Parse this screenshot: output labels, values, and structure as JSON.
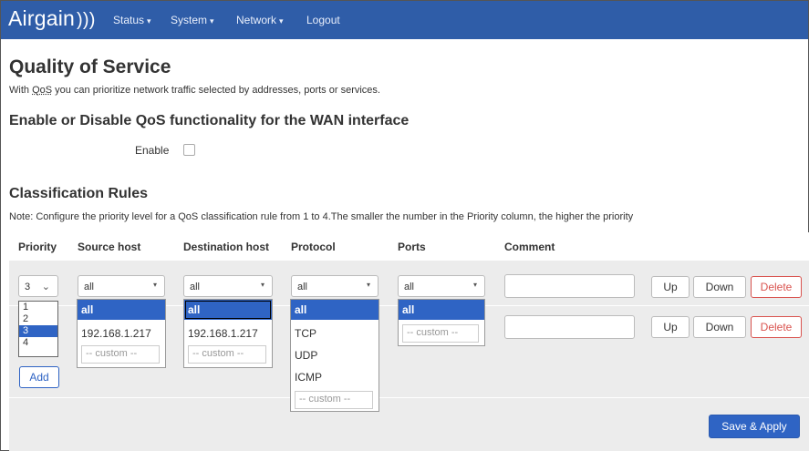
{
  "navbar": {
    "brand": "Airgain",
    "brand_waves": ")))",
    "items": [
      {
        "label": "Status",
        "caret": "▾"
      },
      {
        "label": "System",
        "caret": "▾"
      },
      {
        "label": "Network",
        "caret": "▾"
      },
      {
        "label": "Logout",
        "caret": ""
      }
    ]
  },
  "page": {
    "title": "Quality of Service",
    "desc_prefix": "With ",
    "desc_abbr": "QoS",
    "desc_suffix": " you can prioritize network traffic selected by addresses, ports or services.",
    "section_enable_title": "Enable or Disable QoS functionality for the WAN interface",
    "enable_label": "Enable",
    "enable_checked": false,
    "section_rules_title": "Classification Rules",
    "note": "Note: Configure the priority level for a QoS classification rule from 1 to 4.The smaller the number in the Priority column, the higher the priority"
  },
  "table": {
    "headers": [
      "Priority",
      "Source host",
      "Destination host",
      "Protocol",
      "Ports",
      "Comment"
    ],
    "row1": {
      "priority": "3",
      "source": "all",
      "destination": "all",
      "protocol": "all",
      "ports": "all",
      "comment": ""
    },
    "priority_options": [
      "1",
      "2",
      "3",
      "4"
    ],
    "priority_selected": "3",
    "source_options": [
      "all",
      "192.168.1.217",
      "-- custom --"
    ],
    "destination_options": [
      "all",
      "192.168.1.217",
      "-- custom --"
    ],
    "protocol_options": [
      "all",
      "TCP",
      "UDP",
      "ICMP",
      "-- custom --"
    ],
    "ports_options": [
      "all",
      "-- custom --"
    ],
    "buttons": {
      "up": "Up",
      "down": "Down",
      "delete": "Delete",
      "add": "Add"
    }
  },
  "footer": {
    "save_apply": "Save & Apply"
  },
  "colors": {
    "nav": "#2f5da8",
    "accent": "#2f64c4",
    "danger": "#d9534f"
  }
}
